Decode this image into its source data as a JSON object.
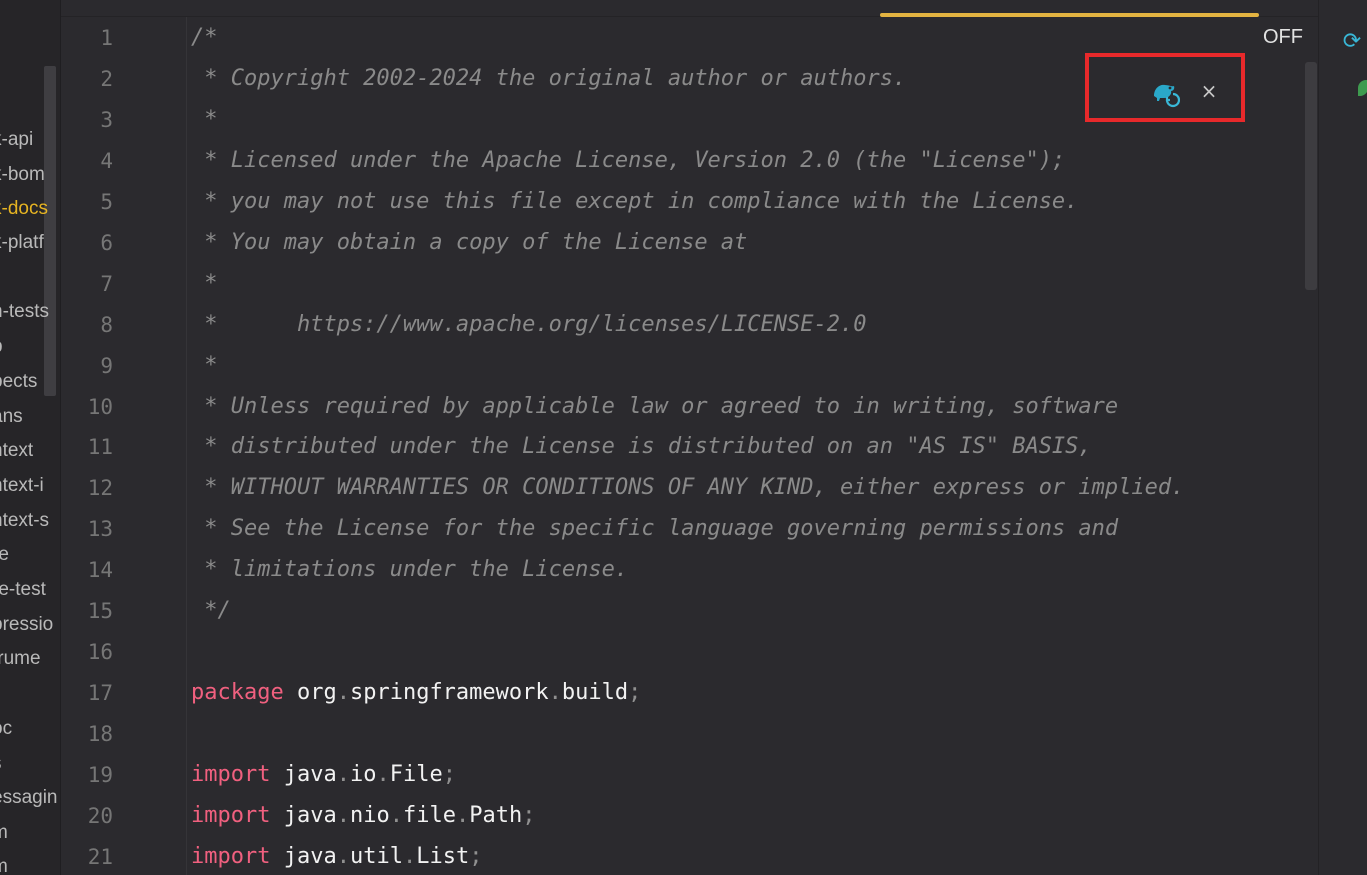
{
  "sidebar": {
    "items": [
      {
        "label": "k-api"
      },
      {
        "label": "k-bom"
      },
      {
        "label": "k-docs"
      },
      {
        "label": "k-platf"
      },
      {
        "label": "n-tests"
      },
      {
        "label": "p"
      },
      {
        "label": "pects"
      },
      {
        "label": "ans"
      },
      {
        "label": "ntext"
      },
      {
        "label": "ntext-i"
      },
      {
        "label": "ntext-s"
      },
      {
        "label": "re"
      },
      {
        "label": "re-test"
      },
      {
        "label": "pressio"
      },
      {
        "label": "trume"
      },
      {
        "label": "oc"
      },
      {
        "label": "s"
      },
      {
        "label": "essagin"
      },
      {
        "label": "m"
      },
      {
        "label": "m"
      }
    ]
  },
  "editor": {
    "line_numbers": [
      "1",
      "2",
      "3",
      "4",
      "5",
      "6",
      "7",
      "8",
      "9",
      "10",
      "11",
      "12",
      "13",
      "14",
      "15",
      "16",
      "17",
      "18",
      "19",
      "20",
      "21"
    ],
    "comment_lines": [
      "/*",
      " * Copyright 2002-2024 the original author or authors.",
      " *",
      " * Licensed under the Apache License, Version 2.0 (the \"License\");",
      " * you may not use this file except in compliance with the License.",
      " * You may obtain a copy of the License at",
      " *",
      " *      https://www.apache.org/licenses/LICENSE-2.0",
      " *",
      " * Unless required by applicable law or agreed to in writing, software",
      " * distributed under the License is distributed on an \"AS IS\" BASIS,",
      " * WITHOUT WARRANTIES OR CONDITIONS OF ANY KIND, either express or implied.",
      " * See the License for the specific language governing permissions and",
      " * limitations under the License.",
      " */"
    ],
    "package_line": {
      "keyword": "package",
      "parts": [
        "org",
        "springframework",
        "build"
      ]
    },
    "imports": [
      {
        "keyword": "import",
        "parts": [
          "java",
          "io",
          "File"
        ]
      },
      {
        "keyword": "import",
        "parts": [
          "java",
          "nio",
          "file",
          "Path"
        ]
      },
      {
        "keyword": "import",
        "parts": [
          "java",
          "util",
          "List"
        ]
      }
    ]
  },
  "toolbar": {
    "off_label": "OFF"
  },
  "popup": {
    "close_glyph": "×"
  },
  "icons": {
    "sync": "sync-icon",
    "reload": "gradle-reload-icon"
  },
  "colors": {
    "keyword": "#f0607f",
    "comment": "#8a8a8a",
    "accent": "#e3b341",
    "highlight": "#e8292b",
    "icon": "#39b7d6"
  }
}
